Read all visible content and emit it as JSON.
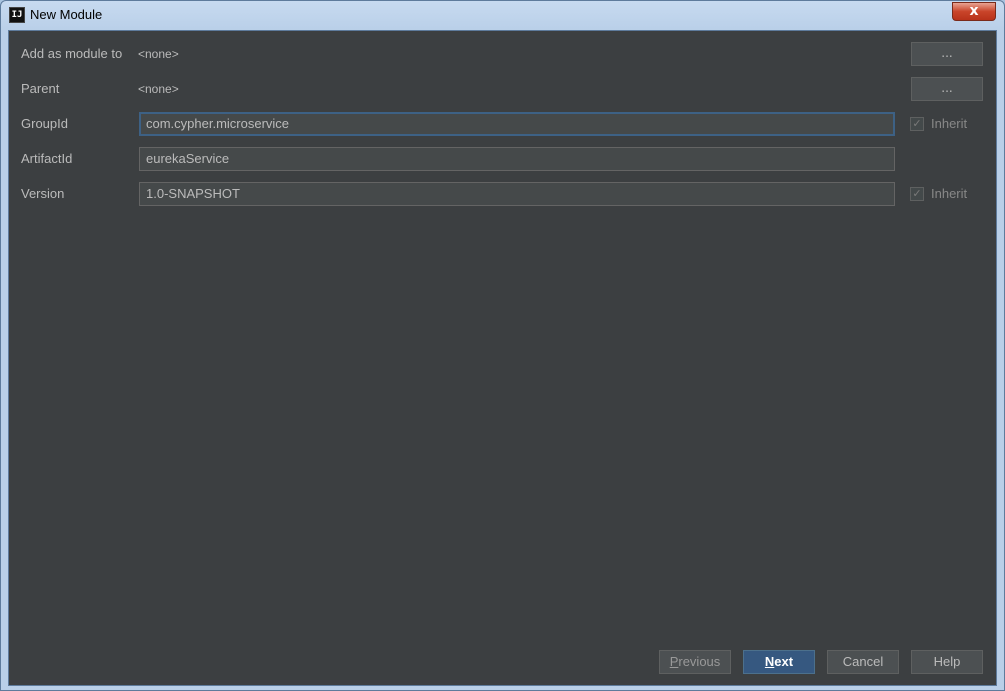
{
  "window": {
    "title": "New Module",
    "app_icon_text": "IJ",
    "close_glyph": "x"
  },
  "form": {
    "add_as_module_to": {
      "label": "Add as module to",
      "value": "<none>",
      "button": "..."
    },
    "parent": {
      "label": "Parent",
      "value": "<none>",
      "button": "..."
    },
    "group_id": {
      "label": "GroupId",
      "value": "com.cypher.microservice",
      "inherit_label": "Inherit",
      "inherit_checked": true
    },
    "artifact_id": {
      "label": "ArtifactId",
      "value": "eurekaService"
    },
    "version": {
      "label": "Version",
      "value": "1.0-SNAPSHOT",
      "inherit_label": "Inherit",
      "inherit_checked": true
    }
  },
  "footer": {
    "previous": {
      "mnemonic": "P",
      "rest": "revious"
    },
    "next": {
      "mnemonic": "N",
      "rest": "ext"
    },
    "cancel": "Cancel",
    "help": "Help"
  },
  "colors": {
    "panel_bg": "#3c3f41",
    "field_bg": "#45494a",
    "text": "#bbbbbb",
    "primary_button": "#365880",
    "focus_border": "#3d6185"
  }
}
